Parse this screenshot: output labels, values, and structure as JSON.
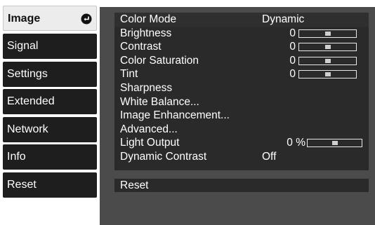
{
  "menu": [
    {
      "label": "Image",
      "active": true
    },
    {
      "label": "Signal",
      "active": false
    },
    {
      "label": "Settings",
      "active": false
    },
    {
      "label": "Extended",
      "active": false
    },
    {
      "label": "Network",
      "active": false
    },
    {
      "label": "Info",
      "active": false
    },
    {
      "label": "Reset",
      "active": false
    }
  ],
  "menu_enter_icon": "enter-arrow-icon",
  "image_settings": {
    "color_mode": {
      "label": "Color Mode",
      "value": "Dynamic"
    },
    "brightness": {
      "label": "Brightness",
      "value": "0",
      "level": 0.5
    },
    "contrast": {
      "label": "Contrast",
      "value": "0",
      "level": 0.5
    },
    "color_saturation": {
      "label": "Color Saturation",
      "value": "0",
      "level": 0.5
    },
    "tint": {
      "label": "Tint",
      "value": "0",
      "level": 0.5
    },
    "sharpness": {
      "label": "Sharpness"
    },
    "white_balance": {
      "label": "White Balance..."
    },
    "image_enhancement": {
      "label": "Image Enhancement..."
    },
    "advanced": {
      "label": "Advanced..."
    },
    "light_output": {
      "label": "Light Output",
      "value": "0 %",
      "level": 0.5
    },
    "dynamic_contrast": {
      "label": "Dynamic Contrast",
      "value": "Off"
    }
  },
  "reset": {
    "label": "Reset"
  },
  "colors": {
    "menu_bg": "#1e1e1e",
    "menu_active_bg": "#ececec",
    "panel_bg": "#4b4b4b",
    "row_bg": "#2a2a2a",
    "text": "#ffffff"
  }
}
